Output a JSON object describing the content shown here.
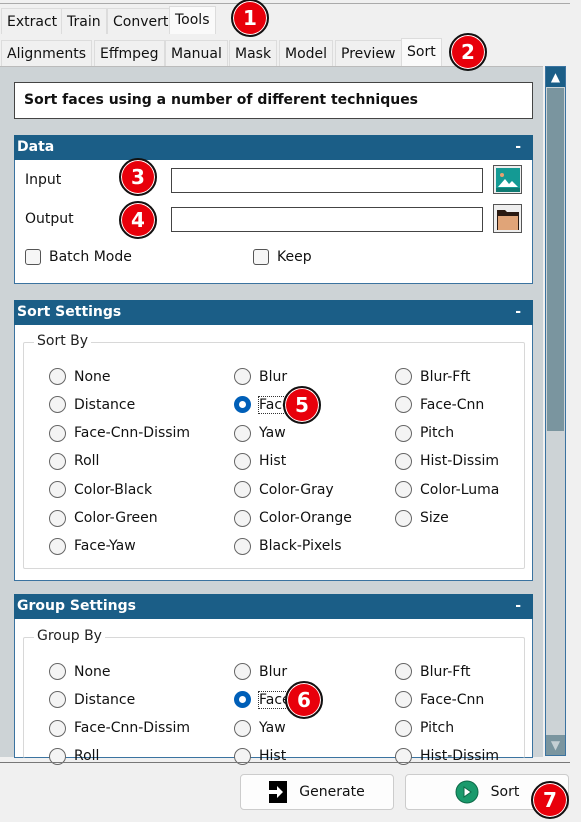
{
  "main_tabs": [
    {
      "label": "Extract"
    },
    {
      "label": "Train"
    },
    {
      "label": "Convert"
    },
    {
      "label": "Tools",
      "active": true
    }
  ],
  "tool_tabs": [
    {
      "label": "Alignments"
    },
    {
      "label": "Effmpeg"
    },
    {
      "label": "Manual"
    },
    {
      "label": "Mask"
    },
    {
      "label": "Model"
    },
    {
      "label": "Preview"
    },
    {
      "label": "Sort",
      "active": true
    }
  ],
  "description": "Sort faces using a number of different techniques",
  "data_section": {
    "title": "Data",
    "collapse": "-",
    "input_label": "Input",
    "input_value": "",
    "output_label": "Output",
    "output_value": "",
    "batch_mode_label": "Batch Mode",
    "batch_mode": false,
    "keep_label": "Keep",
    "keep": false,
    "input_icon": "image-icon",
    "output_icon": "folder-icon"
  },
  "sort_settings": {
    "title": "Sort Settings",
    "collapse": "-",
    "group_label": "Sort By",
    "selected": "Face",
    "options": [
      "None",
      "Blur",
      "Blur-Fft",
      "Distance",
      "Face",
      "Face-Cnn",
      "Face-Cnn-Dissim",
      "Yaw",
      "Pitch",
      "Roll",
      "Hist",
      "Hist-Dissim",
      "Color-Black",
      "Color-Gray",
      "Color-Luma",
      "Color-Green",
      "Color-Orange",
      "Size",
      "Face-Yaw",
      "Black-Pixels"
    ]
  },
  "group_settings": {
    "title": "Group Settings",
    "collapse": "-",
    "group_label": "Group By",
    "selected": "Face",
    "options": [
      "None",
      "Blur",
      "Blur-Fft",
      "Distance",
      "Face",
      "Face-Cnn",
      "Face-Cnn-Dissim",
      "Yaw",
      "Pitch",
      "Roll",
      "Hist",
      "Hist-Dissim"
    ]
  },
  "buttons": {
    "generate": "Generate",
    "sort": "Sort"
  },
  "markers": [
    "1",
    "2",
    "3",
    "4",
    "5",
    "6",
    "7"
  ],
  "colors": {
    "header": "#1b5e87",
    "marker": "#e8000b",
    "radio_selected": "#005fb8",
    "sort_icon": "#1a9a6c"
  }
}
